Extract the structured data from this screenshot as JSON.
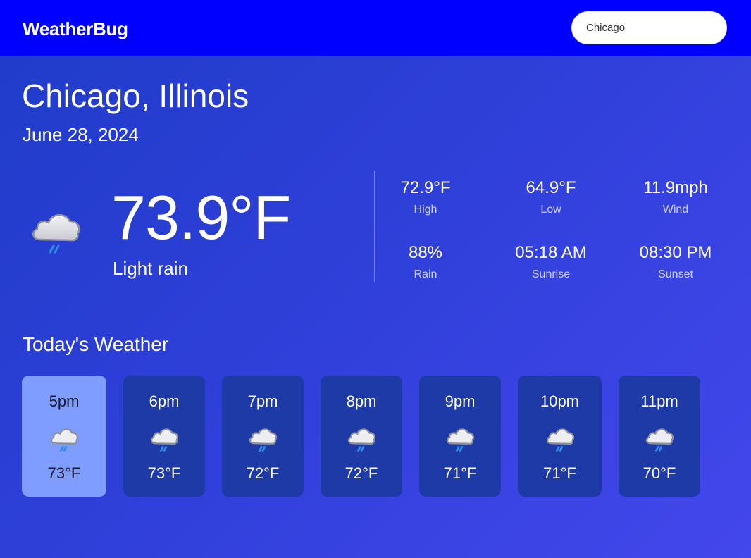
{
  "header": {
    "brand": "WeatherBug",
    "search_value": "Chicago"
  },
  "location": {
    "city": "Chicago, Illinois",
    "date": "June 28, 2024"
  },
  "current": {
    "icon": "rain-cloud-icon",
    "temperature": "73.9°F",
    "condition": "Light rain"
  },
  "stats": [
    {
      "value": "72.9°F",
      "label": "High"
    },
    {
      "value": "64.9°F",
      "label": "Low"
    },
    {
      "value": "11.9mph",
      "label": "Wind"
    },
    {
      "value": "88%",
      "label": "Rain"
    },
    {
      "value": "05:18 AM",
      "label": "Sunrise"
    },
    {
      "value": "08:30 PM",
      "label": "Sunset"
    }
  ],
  "today": {
    "title": "Today's Weather",
    "hours": [
      {
        "time": "5pm",
        "temp": "73°F",
        "icon": "rain-cloud-icon",
        "active": true
      },
      {
        "time": "6pm",
        "temp": "73°F",
        "icon": "rain-cloud-icon",
        "active": false
      },
      {
        "time": "7pm",
        "temp": "72°F",
        "icon": "rain-cloud-icon",
        "active": false
      },
      {
        "time": "8pm",
        "temp": "72°F",
        "icon": "rain-cloud-icon",
        "active": false
      },
      {
        "time": "9pm",
        "temp": "71°F",
        "icon": "rain-cloud-icon",
        "active": false
      },
      {
        "time": "10pm",
        "temp": "71°F",
        "icon": "rain-cloud-icon",
        "active": false
      },
      {
        "time": "11pm",
        "temp": "70°F",
        "icon": "rain-cloud-icon",
        "active": false
      }
    ]
  },
  "colors": {
    "header_bg": "#0000ff",
    "card_bg": "#1e3aa6",
    "active_card_bg": "#7f9cff"
  }
}
